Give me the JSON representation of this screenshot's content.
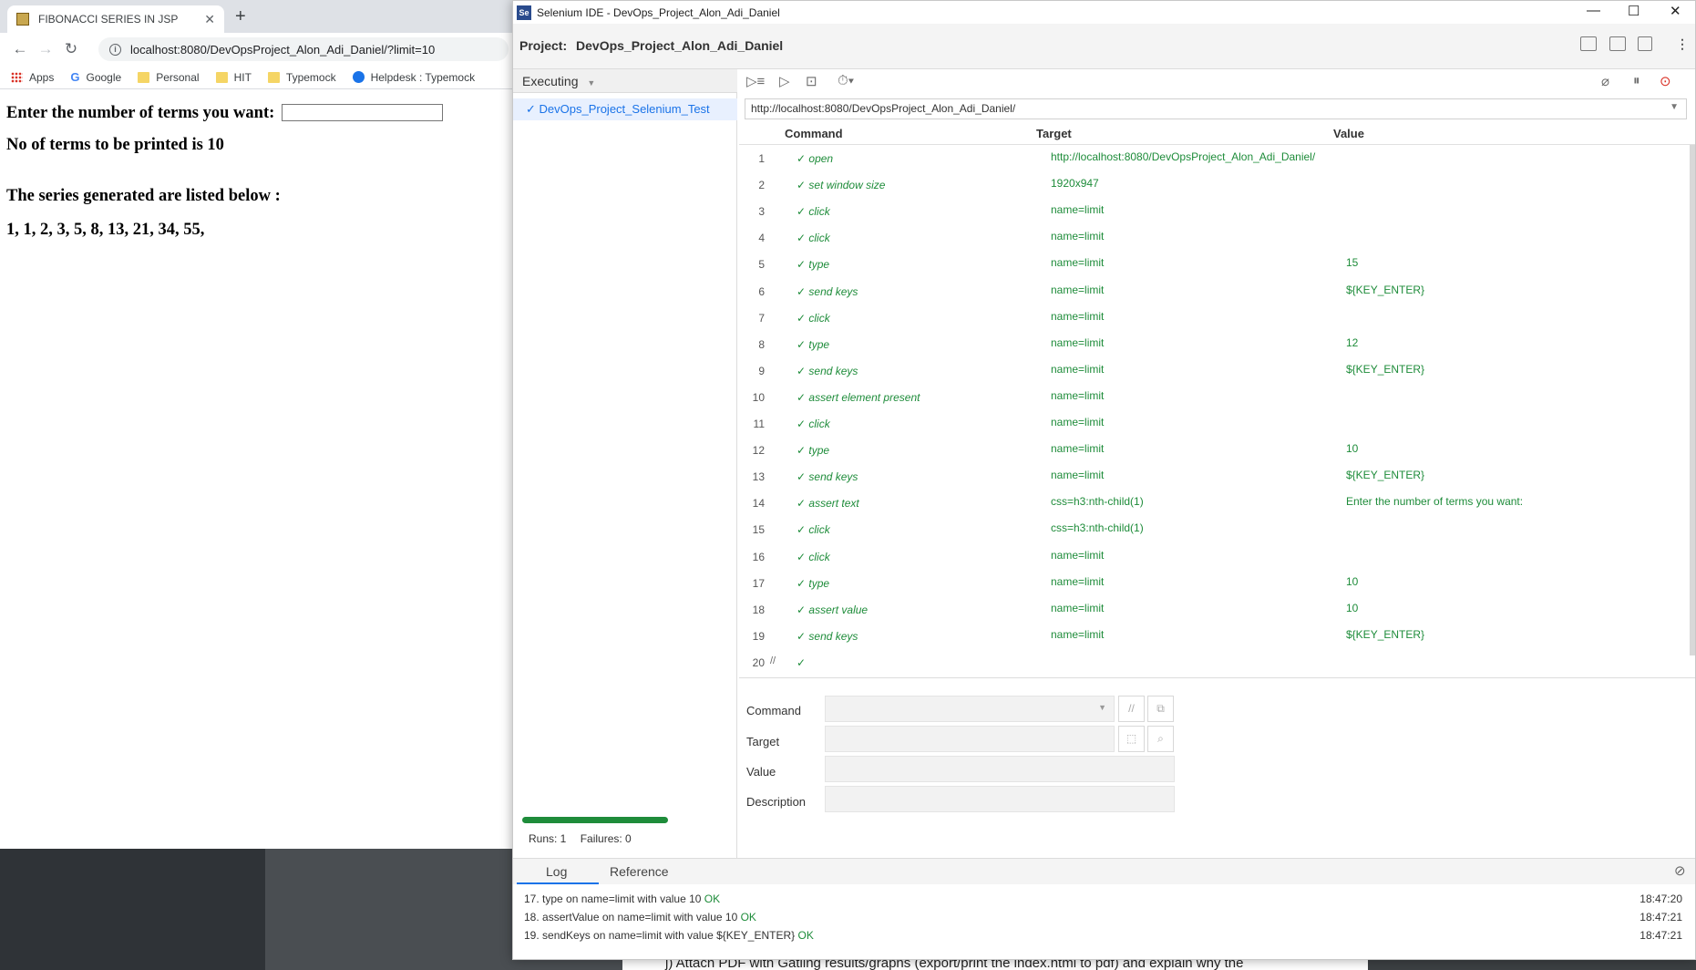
{
  "browser": {
    "tab_title": "FIBONACCI SERIES IN JSP",
    "url": "localhost:8080/DevOpsProject_Alon_Adi_Daniel/?limit=10",
    "bookmarks": [
      "Apps",
      "Google",
      "Personal",
      "HIT",
      "Typemock",
      "Helpdesk : Typemock"
    ]
  },
  "page": {
    "prompt": "Enter the number of terms you want:",
    "count_text": "No of terms to be printed is 10",
    "series_heading": "The series generated are listed below :",
    "series": "1, 1, 2, 3, 5, 8, 13, 21, 34, 55,"
  },
  "ide": {
    "window_title": "Selenium IDE - DevOps_Project_Alon_Adi_Daniel",
    "project_label": "Project:",
    "project_name": "DevOps_Project_Alon_Adi_Daniel",
    "executing_label": "Executing",
    "test_name": "DevOps_Project_Selenium_Test",
    "runs_text": "Runs: 1",
    "failures_text": "Failures: 0",
    "progress": 1.0,
    "base_url": "http://localhost:8080/DevOpsProject_Alon_Adi_Daniel/",
    "columns": {
      "command": "Command",
      "target": "Target",
      "value": "Value"
    },
    "commands": [
      {
        "n": "1",
        "cmd": "open",
        "target": "http://localhost:8080/DevOpsProject_Alon_Adi_Daniel/",
        "value": ""
      },
      {
        "n": "2",
        "cmd": "set window size",
        "target": "1920x947",
        "value": ""
      },
      {
        "n": "3",
        "cmd": "click",
        "target": "name=limit",
        "value": ""
      },
      {
        "n": "4",
        "cmd": "click",
        "target": "name=limit",
        "value": ""
      },
      {
        "n": "5",
        "cmd": "type",
        "target": "name=limit",
        "value": "15"
      },
      {
        "n": "6",
        "cmd": "send keys",
        "target": "name=limit",
        "value": "${KEY_ENTER}"
      },
      {
        "n": "7",
        "cmd": "click",
        "target": "name=limit",
        "value": ""
      },
      {
        "n": "8",
        "cmd": "type",
        "target": "name=limit",
        "value": "12"
      },
      {
        "n": "9",
        "cmd": "send keys",
        "target": "name=limit",
        "value": "${KEY_ENTER}"
      },
      {
        "n": "10",
        "cmd": "assert element present",
        "target": "name=limit",
        "value": ""
      },
      {
        "n": "11",
        "cmd": "click",
        "target": "name=limit",
        "value": ""
      },
      {
        "n": "12",
        "cmd": "type",
        "target": "name=limit",
        "value": "10"
      },
      {
        "n": "13",
        "cmd": "send keys",
        "target": "name=limit",
        "value": "${KEY_ENTER}"
      },
      {
        "n": "14",
        "cmd": "assert text",
        "target": "css=h3:nth-child(1)",
        "value": "Enter the number of terms you want:"
      },
      {
        "n": "15",
        "cmd": "click",
        "target": "css=h3:nth-child(1)",
        "value": ""
      },
      {
        "n": "16",
        "cmd": "click",
        "target": "name=limit",
        "value": ""
      },
      {
        "n": "17",
        "cmd": "type",
        "target": "name=limit",
        "value": "10"
      },
      {
        "n": "18",
        "cmd": "assert value",
        "target": "name=limit",
        "value": "10"
      },
      {
        "n": "19",
        "cmd": "send keys",
        "target": "name=limit",
        "value": "${KEY_ENTER}"
      },
      {
        "n": "20",
        "cmd": "",
        "target": "",
        "value": ""
      }
    ],
    "editor": {
      "command_label": "Command",
      "target_label": "Target",
      "value_label": "Value",
      "description_label": "Description"
    },
    "log_tabs": {
      "log": "Log",
      "reference": "Reference"
    },
    "log": [
      {
        "text": "17. type on name=limit with value 10",
        "status": "OK",
        "time": "18:47:20"
      },
      {
        "text": "18. assertValue on name=limit with value 10",
        "status": "OK",
        "time": "18:47:21"
      },
      {
        "text": "19. sendKeys on name=limit with value ${KEY_ENTER}",
        "status": "OK",
        "time": "18:47:21"
      }
    ]
  },
  "background_doc": {
    "line": "j)    Attach PDF with Gatling results/graphs (export/print the index.html to pdf) and explain why the"
  }
}
